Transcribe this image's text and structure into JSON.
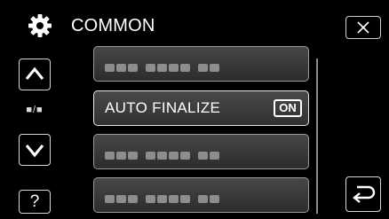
{
  "header": {
    "title": "COMMON",
    "icon": "gear-icon"
  },
  "nav": {
    "up_icon": "chevron-up-icon",
    "down_icon": "chevron-down-icon",
    "page_indicator": "■/■",
    "help_label": "?"
  },
  "menu": {
    "items": [
      {
        "label": "",
        "blurred": true
      },
      {
        "label": "AUTO FINALIZE",
        "value": "ON",
        "selected": true
      },
      {
        "label": "",
        "blurred": true
      },
      {
        "label": "",
        "blurred": true
      }
    ]
  },
  "controls": {
    "close_icon": "close-icon",
    "back_icon": "back-arrow-icon"
  },
  "colors": {
    "background": "#000000",
    "item_fill": "#3a3a3a",
    "text": "#ffffff",
    "border": "#d8d8d8"
  }
}
